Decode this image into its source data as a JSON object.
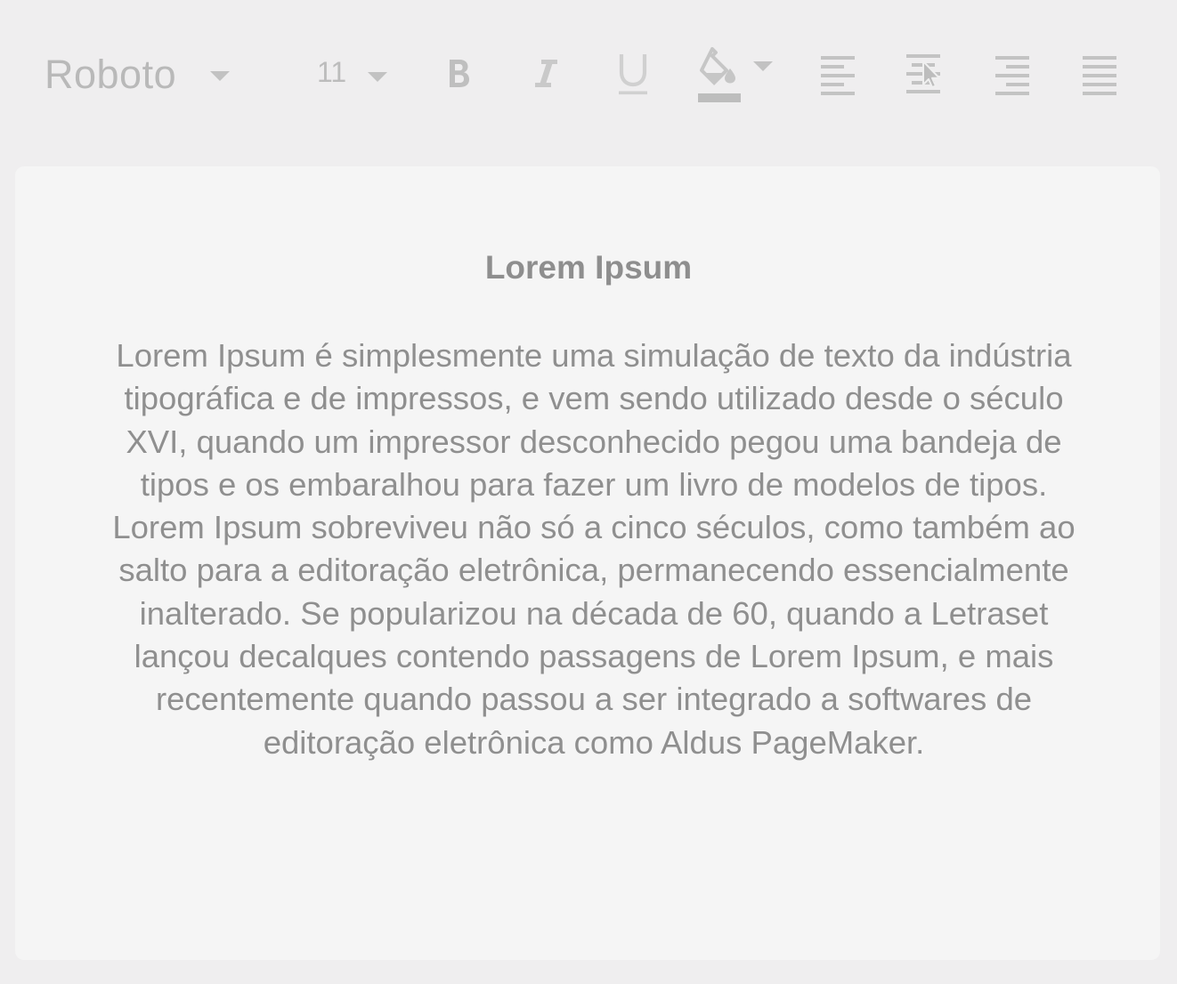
{
  "toolbar": {
    "font_family": "Roboto",
    "font_size": "11",
    "bold_icon": "bold-icon",
    "italic_icon": "italic-icon",
    "underline_icon": "underline-icon",
    "fill_color_icon": "paint-bucket-icon",
    "align_left_icon": "align-left-icon",
    "align_center_icon": "align-center-icon",
    "align_right_icon": "align-right-icon",
    "align_justify_icon": "align-justify-icon",
    "icon_color": "#bdbdbd"
  },
  "document": {
    "title": "Lorem Ipsum",
    "body": "Lorem Ipsum é simplesmente uma simulação de texto da indústria tipográfica e de impressos, e vem sendo utilizado desde o século XVI, quando um impressor desconhecido pegou uma bandeja de tipos e os embaralhou para fazer um livro de modelos de tipos. Lorem Ipsum sobreviveu não só a cinco séculos, como também ao salto para a editoração eletrônica, permanecendo essencialmente inalterado. Se popularizou na década de 60, quando a Letraset lançou decalques contendo passagens de Lorem Ipsum, e mais recentemente quando passou a ser integrado a softwares de editoração eletrônica como Aldus PageMaker."
  }
}
